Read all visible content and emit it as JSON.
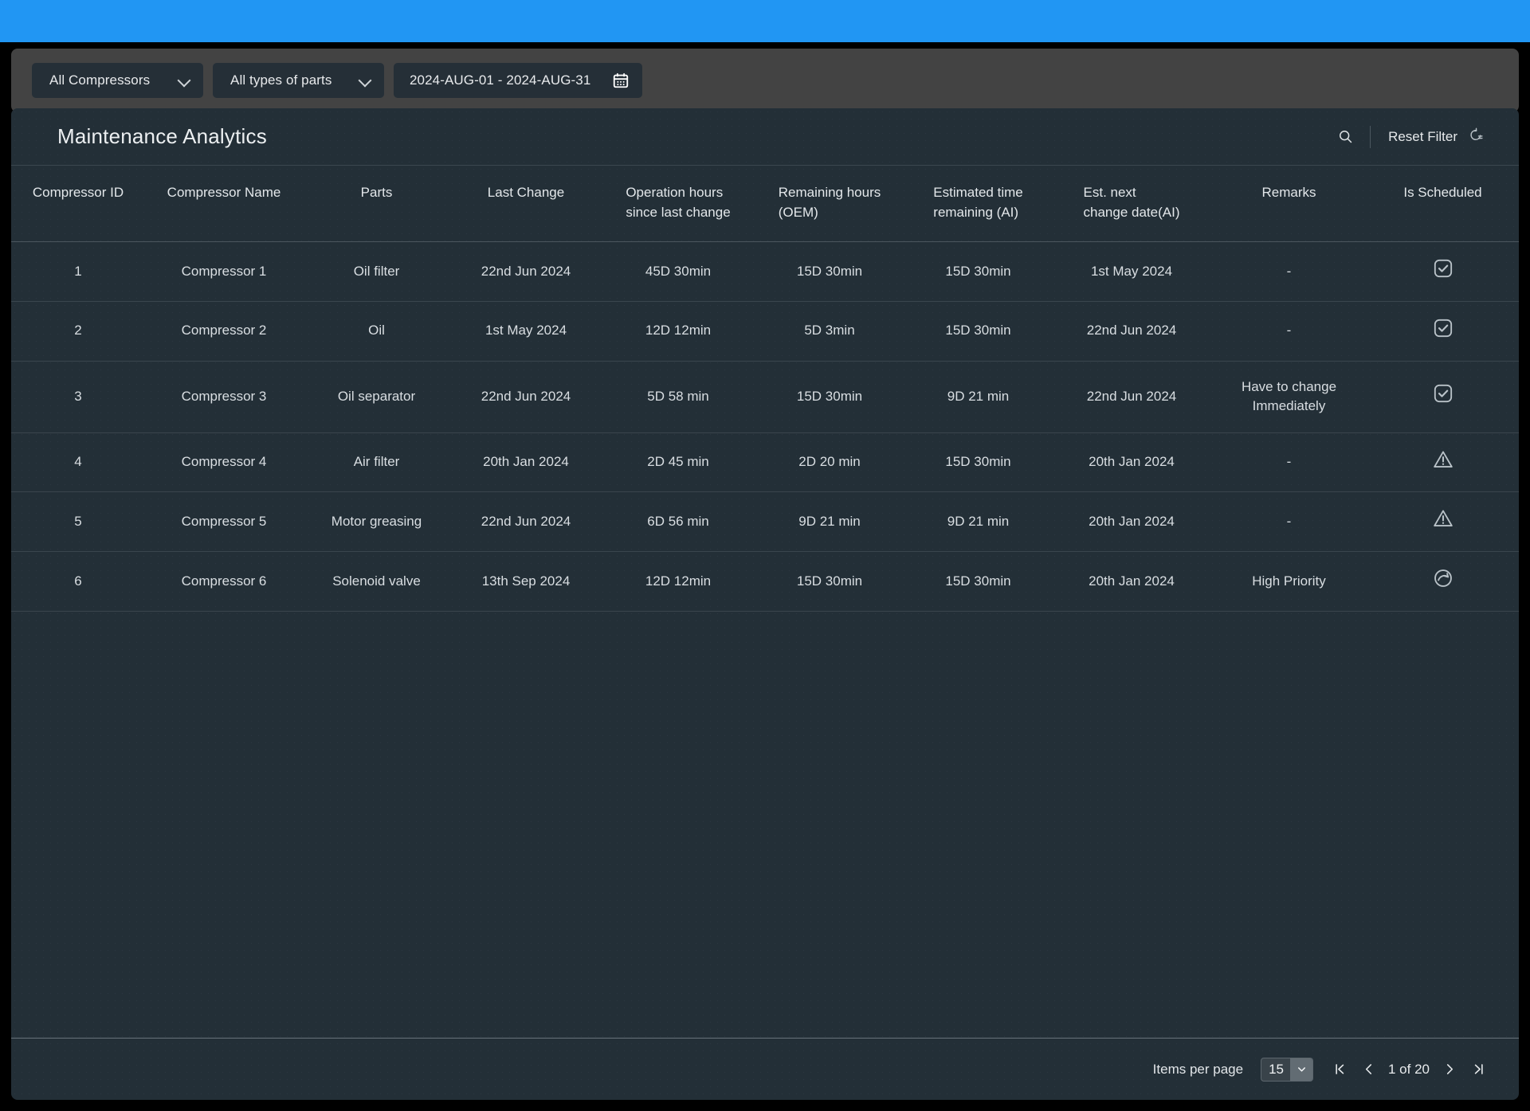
{
  "topbar": {
    "color": "#2196f3"
  },
  "filters": {
    "compressor_select": {
      "value": "All Compressors",
      "icon": "chevron-down-icon"
    },
    "parts_select": {
      "value": "All types of parts",
      "icon": "chevron-down-icon"
    },
    "date_range": {
      "value": "2024-AUG-01 - 2024-AUG-31",
      "icon": "calendar-icon"
    }
  },
  "panel": {
    "title": "Maintenance Analytics",
    "search_icon": "search-icon",
    "reset_filter_label": "Reset Filter",
    "reset_filter_icon": "filter-reset-icon"
  },
  "table": {
    "columns": [
      "Compressor ID",
      "Compressor Name",
      "Parts",
      "Last Change",
      "Operation hours\nsince last change",
      "Remaining hours\n(OEM)",
      "Estimated time\nremaining (AI)",
      "Est. next\nchange date(AI)",
      "Remarks",
      "Is Scheduled"
    ],
    "rows": [
      {
        "id": "1",
        "name": "Compressor 1",
        "parts": "Oil filter",
        "last_change": "22nd Jun 2024",
        "operation_hours": "45D 30min",
        "remaining_hours_oem": "15D 30min",
        "estimated_time_ai": "15D 30min",
        "est_next_change_ai": "1st May 2024",
        "remarks": "-",
        "is_scheduled": "check-square-icon"
      },
      {
        "id": "2",
        "name": "Compressor 2",
        "parts": "Oil",
        "last_change": "1st May 2024",
        "operation_hours": "12D 12min",
        "remaining_hours_oem": "5D 3min",
        "estimated_time_ai": "15D 30min",
        "est_next_change_ai": "22nd Jun 2024",
        "remarks": "-",
        "is_scheduled": "check-square-icon"
      },
      {
        "id": "3",
        "name": "Compressor 3",
        "parts": "Oil separator",
        "last_change": "22nd Jun 2024",
        "operation_hours": "5D 58 min",
        "remaining_hours_oem": "15D 30min",
        "estimated_time_ai": "9D 21 min",
        "est_next_change_ai": "22nd Jun 2024",
        "remarks": "Have to change\nImmediately",
        "is_scheduled": "check-square-icon"
      },
      {
        "id": "4",
        "name": "Compressor 4",
        "parts": "Air filter",
        "last_change": "20th Jan 2024",
        "operation_hours": "2D 45 min",
        "remaining_hours_oem": "2D 20 min",
        "estimated_time_ai": "15D 30min",
        "est_next_change_ai": "20th Jan 2024",
        "remarks": "-",
        "is_scheduled": "warning-triangle-icon"
      },
      {
        "id": "5",
        "name": "Compressor 5",
        "parts": "Motor greasing",
        "last_change": "22nd Jun 2024",
        "operation_hours": "6D 56 min",
        "remaining_hours_oem": "9D 21 min",
        "estimated_time_ai": "9D 21 min",
        "est_next_change_ai": "20th Jan 2024",
        "remarks": "-",
        "is_scheduled": "warning-triangle-icon"
      },
      {
        "id": "6",
        "name": "Compressor 6",
        "parts": "Solenoid valve",
        "last_change": "13th Sep 2024",
        "operation_hours": "12D 12min",
        "remaining_hours_oem": "15D 30min",
        "estimated_time_ai": "15D 30min",
        "est_next_change_ai": "20th Jan 2024",
        "remarks": "High Priority",
        "is_scheduled": "refresh-circle-icon"
      }
    ]
  },
  "pagination": {
    "items_per_page_label": "Items per page",
    "items_per_page_value": "15",
    "page_status": "1 of 20",
    "first_icon": "first-page-icon",
    "prev_icon": "previous-page-icon",
    "next_icon": "next-page-icon",
    "last_icon": "last-page-icon"
  }
}
